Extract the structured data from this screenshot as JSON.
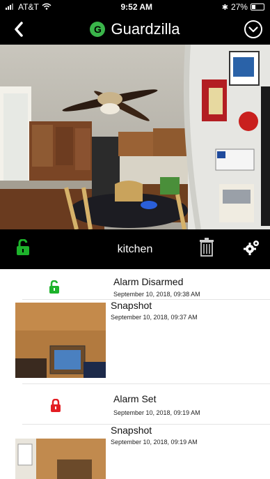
{
  "status": {
    "carrier": "AT&T",
    "time": "9:52 AM",
    "battery": "27%",
    "battery_level": 0.27
  },
  "header": {
    "brand": "Guardzilla"
  },
  "camera": {
    "name": "kitchen"
  },
  "events": [
    {
      "type": "alarm_disarmed",
      "title": "Alarm Disarmed",
      "date": "September 10, 2018, 09:38 AM"
    },
    {
      "type": "snapshot",
      "title": "Snapshot",
      "date": "September 10, 2018, 09:37 AM"
    },
    {
      "type": "alarm_set",
      "title": "Alarm Set",
      "date": "September 10, 2018, 09:19 AM"
    },
    {
      "type": "snapshot",
      "title": "Snapshot",
      "date": "September 10, 2018, 09:19 AM"
    }
  ],
  "colors": {
    "green": "#1db32b",
    "red": "#e31e24",
    "black": "#000000"
  }
}
